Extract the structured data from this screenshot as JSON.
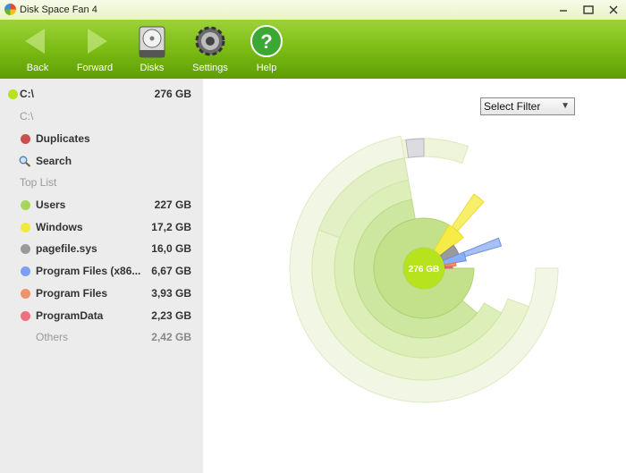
{
  "window": {
    "title": "Disk Space Fan 4",
    "controls": [
      "minimize",
      "maximize",
      "close"
    ]
  },
  "toolbar": [
    {
      "id": "back",
      "label": "Back",
      "icon": "back-arrow-icon"
    },
    {
      "id": "forward",
      "label": "Forward",
      "icon": "forward-arrow-icon"
    },
    {
      "id": "disks",
      "label": "Disks",
      "icon": "hard-disk-icon"
    },
    {
      "id": "settings",
      "label": "Settings",
      "icon": "gear-icon"
    },
    {
      "id": "help",
      "label": "Help",
      "icon": "help-icon"
    }
  ],
  "sidebar": {
    "drive": {
      "label": "C:\\",
      "size": "276 GB",
      "color": "#b6e21e"
    },
    "path": "C:\\",
    "duplicates": {
      "label": "Duplicates",
      "color": "#c9524e"
    },
    "search": {
      "label": "Search",
      "icon": "magnifier-icon"
    },
    "top_list_header": "Top List",
    "top_list": [
      {
        "label": "Users",
        "size": "227 GB",
        "color": "#a8d65a"
      },
      {
        "label": "Windows",
        "size": "17,2 GB",
        "color": "#f2ea3a"
      },
      {
        "label": "pagefile.sys",
        "size": "16,0 GB",
        "color": "#9a9a9a"
      },
      {
        "label": "Program Files (x86...",
        "size": "6,67 GB",
        "color": "#7b9ff2"
      },
      {
        "label": "Program Files",
        "size": "3,93 GB",
        "color": "#f0926a"
      },
      {
        "label": "ProgramData",
        "size": "2,23 GB",
        "color": "#ef7180"
      }
    ],
    "others": {
      "label": "Others",
      "size": "2,42 GB"
    }
  },
  "main": {
    "filter": {
      "selected": "Select Filter"
    },
    "center_label": "276 GB"
  },
  "colors": {
    "accent": "#7cbc14",
    "chart_light": "#e6f3c9",
    "chart_mid": "#c8e597"
  }
}
